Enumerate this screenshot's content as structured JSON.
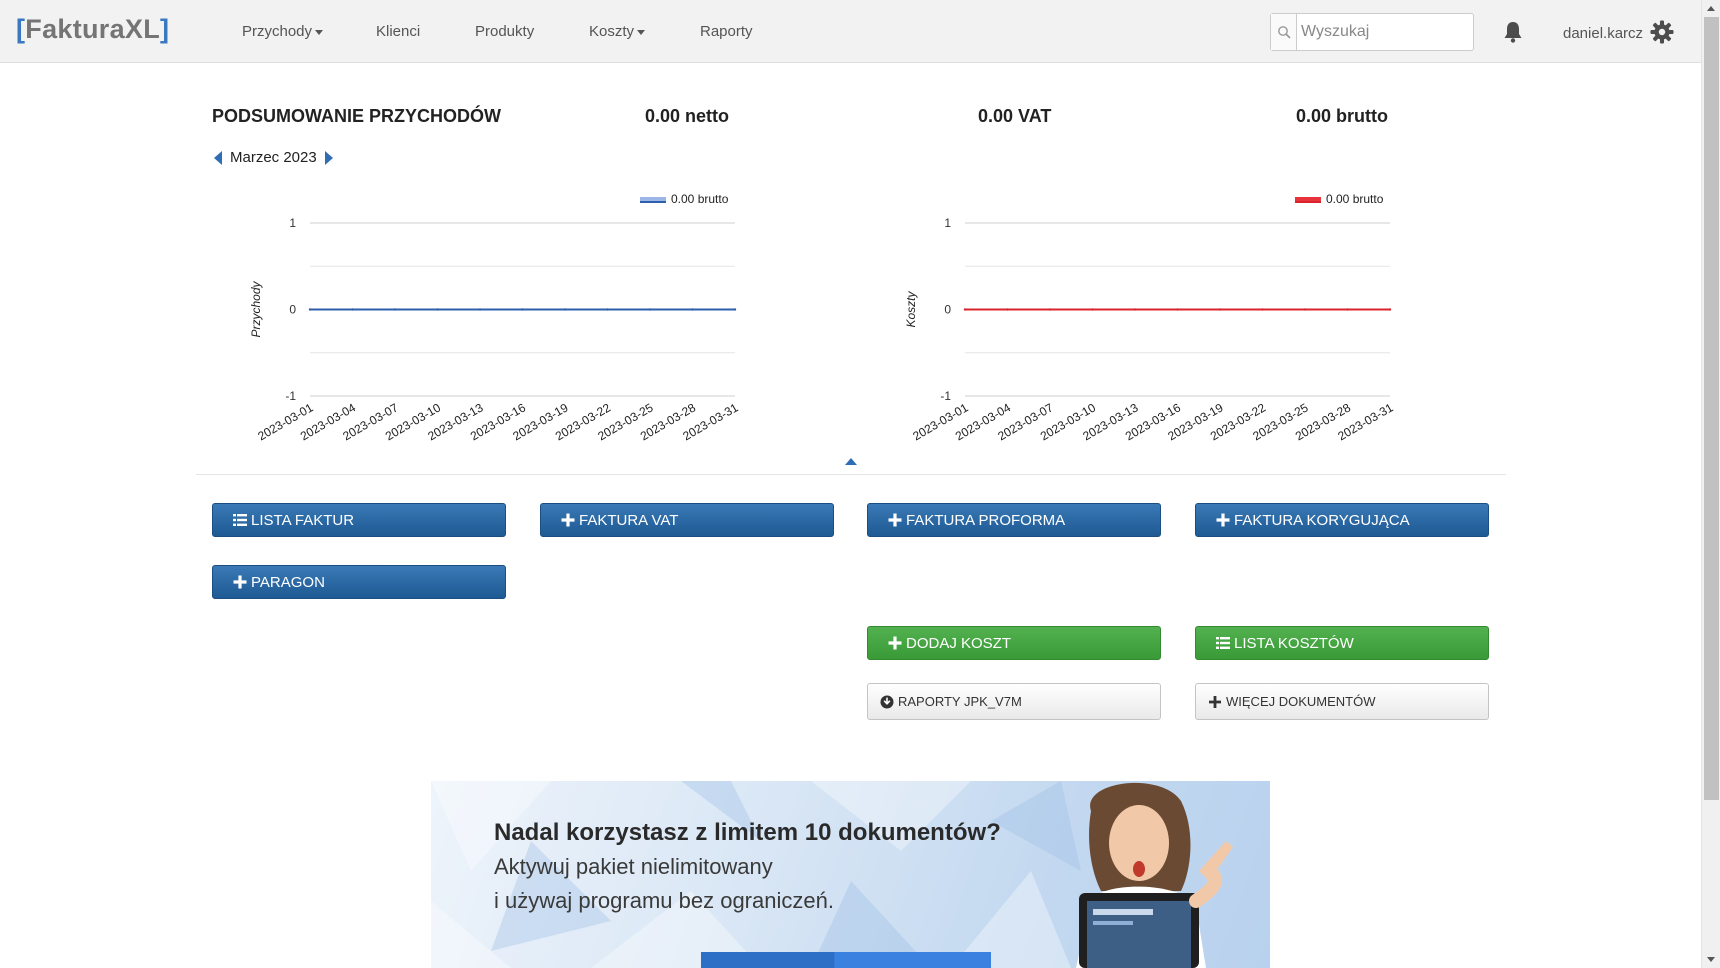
{
  "navbar": {
    "brand_open": "[",
    "brand_name": "FakturaXL",
    "brand_close": "]",
    "items": [
      {
        "label": "Przychody",
        "dropdown": true
      },
      {
        "label": "Klienci",
        "dropdown": false
      },
      {
        "label": "Produkty",
        "dropdown": false
      },
      {
        "label": "Koszty",
        "dropdown": true
      },
      {
        "label": "Raporty",
        "dropdown": false
      }
    ],
    "search_placeholder": "Wyszukaj",
    "username": "daniel.karcz",
    "icons": {
      "search": "search-icon",
      "bell": "bell-icon",
      "settings": "gear-icon"
    }
  },
  "summary": {
    "title": "PODSUMOWANIE PRZYCHODÓW",
    "netto": "0.00 netto",
    "vat": "0.00 VAT",
    "brutto": "0.00 brutto",
    "month": "Marzec 2023"
  },
  "chart_data": [
    {
      "type": "line",
      "ylabel": "Przychody",
      "x": [
        "2023-03-01",
        "2023-03-04",
        "2023-03-07",
        "2023-03-10",
        "2023-03-13",
        "2023-03-16",
        "2023-03-19",
        "2023-03-22",
        "2023-03-25",
        "2023-03-28",
        "2023-03-31"
      ],
      "series": [
        {
          "name": "0.00 brutto",
          "values": [
            0,
            0,
            0,
            0,
            0,
            0,
            0,
            0,
            0,
            0,
            0
          ],
          "color": "#2f5faa",
          "legend_color": "#9db6e8"
        }
      ],
      "ylim": [
        -1,
        1
      ],
      "yticks": [
        "1",
        "0",
        "-1"
      ],
      "legend": "top-right",
      "grid": true
    },
    {
      "type": "line",
      "ylabel": "Koszty",
      "x": [
        "2023-03-01",
        "2023-03-04",
        "2023-03-07",
        "2023-03-10",
        "2023-03-13",
        "2023-03-16",
        "2023-03-19",
        "2023-03-22",
        "2023-03-25",
        "2023-03-28",
        "2023-03-31"
      ],
      "series": [
        {
          "name": "0.00 brutto",
          "values": [
            0,
            0,
            0,
            0,
            0,
            0,
            0,
            0,
            0,
            0,
            0
          ],
          "color": "#d9242b",
          "legend_color": "#e8333a"
        }
      ],
      "ylim": [
        -1,
        1
      ],
      "yticks": [
        "1",
        "0",
        "-1"
      ],
      "legend": "top-right",
      "grid": true
    }
  ],
  "buttons": {
    "lista_faktur": "LISTA FAKTUR",
    "faktura_vat": "FAKTURA VAT",
    "faktura_proforma": "FAKTURA PROFORMA",
    "faktura_korygujaca": "FAKTURA KORYGUJĄCA",
    "paragon": "PARAGON",
    "dodaj_koszt": "DODAJ KOSZT",
    "lista_kosztow": "LISTA KOSZTÓW",
    "raporty_jpk": "RAPORTY JPK_V7M",
    "wiecej_dokumentow": "WIĘCEJ DOKUMENTÓW"
  },
  "colors": {
    "primary": "#2a6aa8",
    "success": "#46a843",
    "brand_bracket": "#3a78c0"
  },
  "banner": {
    "headline": "Nadal korzystasz z limitem 10 dokumentów?",
    "line1": "Aktywuj pakiet nielimitowany",
    "line2": "i używaj programu bez ograniczeń."
  }
}
